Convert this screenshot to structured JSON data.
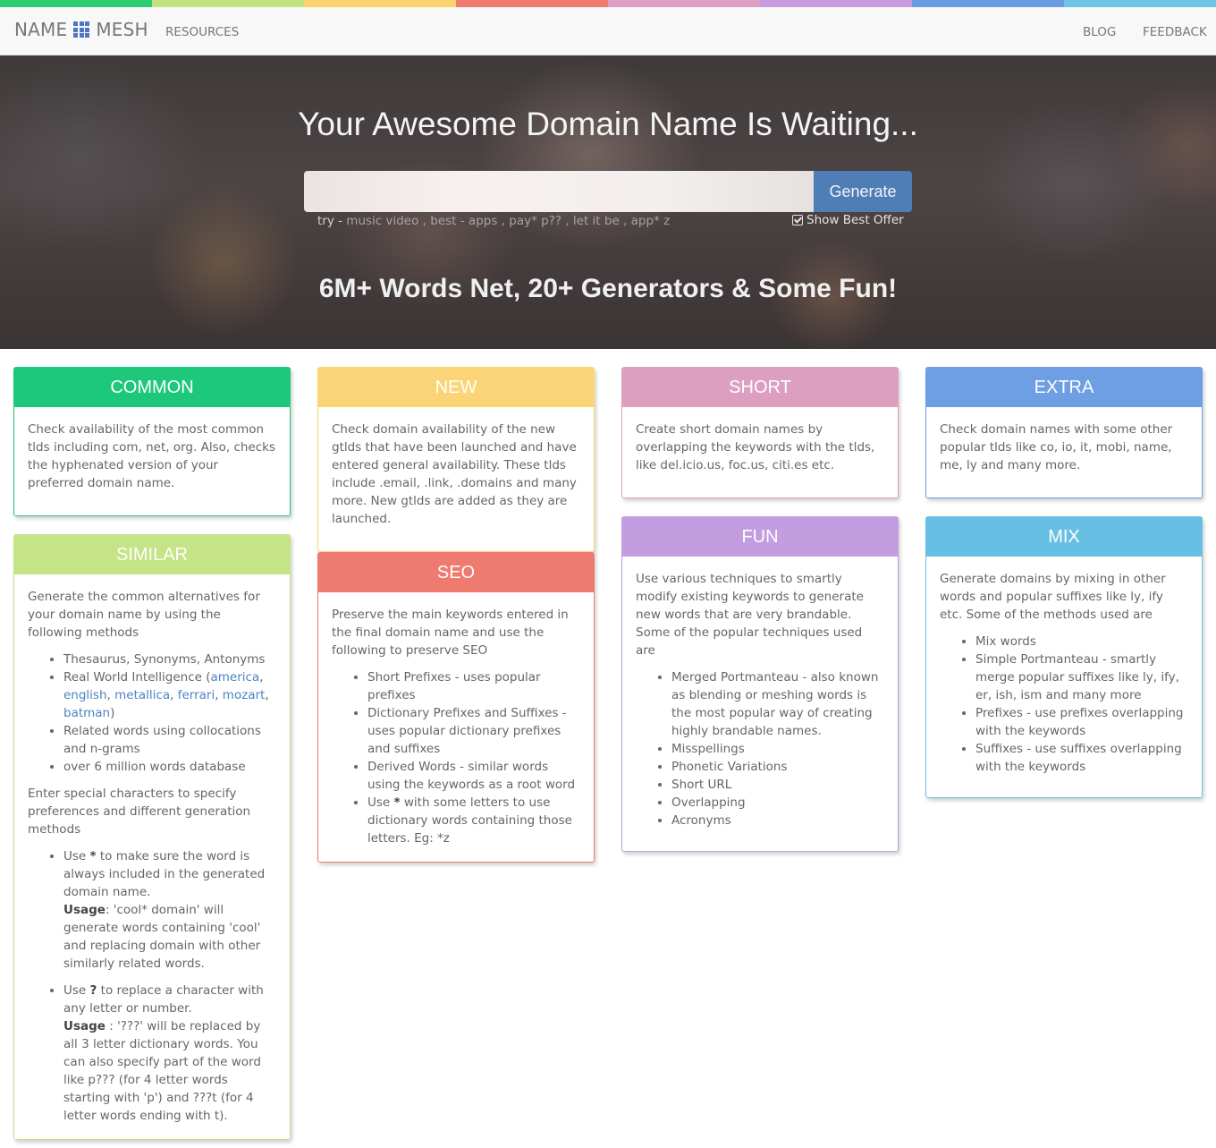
{
  "colors": {
    "strip": [
      "#2ecc71",
      "#c3e27f",
      "#fcd36f",
      "#ef7c6e",
      "#df9fc4",
      "#c79be0",
      "#6b9be3",
      "#6fc6e4"
    ],
    "common": "#1ec87a",
    "similar": "#c5e387",
    "new": "#fbd477",
    "seo": "#ef7a6f",
    "short": "#dc9fbf",
    "fun": "#c39ddf",
    "extra": "#6e9ee3",
    "mix": "#67c0e3"
  },
  "nav": {
    "brand_left": "NAME",
    "brand_icon": "grid-icon",
    "brand_right": "MESH",
    "resources": "RESOURCES",
    "blog": "BLOG",
    "feedback": "FEEDBACK"
  },
  "hero": {
    "title": "Your Awesome Domain Name Is Waiting...",
    "search_value": "",
    "search_placeholder": "",
    "generate_label": "Generate",
    "try_label": "try - ",
    "try_items": [
      "music video",
      "best - apps",
      "pay* p??",
      "let it be",
      "app* z"
    ],
    "show_best_offer": "Show Best Offer",
    "subtitle": "6M+ Words Net, 20+ Generators & Some Fun!"
  },
  "cards": {
    "common": {
      "title": "COMMON",
      "text": "Check availability of the most common tlds including com, net, org. Also, checks the hyphenated version of your preferred domain name."
    },
    "new": {
      "title": "NEW",
      "text": "Check domain availability of the new gtlds that have been launched and have entered general availability. These tlds include .email, .link, .domains and many more. New gtlds are added as they are launched."
    },
    "short": {
      "title": "SHORT",
      "text": "Create short domain names by overlapping the keywords with the tlds, like del.icio.us, foc.us, citi.es etc."
    },
    "extra": {
      "title": "EXTRA",
      "text": "Check domain names with some other popular tlds like co, io, it, mobi, name, me, ly and many more."
    },
    "similar": {
      "title": "SIMILAR",
      "intro": "Generate the common alternatives for your domain name by using the following methods",
      "item1": "Thesaurus, Synonyms, Antonyms",
      "item2_prefix": "Real World Intelligence (",
      "item2_links": [
        "america",
        "english",
        "metallica",
        "ferrari",
        "mozart",
        "batman"
      ],
      "item2_suffix": ")",
      "item3": "Related words using collocations and n-grams",
      "item4": "over 6 million words database",
      "special_intro": "Enter special characters to specify preferences and different generation methods",
      "star_pre": "Use ",
      "star_char": "*",
      "star_post": " to make sure the word is always included in the generated domain name.",
      "star_usage_label": "Usage",
      "star_usage_text": ": 'cool* domain' will generate words containing 'cool' and replacing domain with other similarly related words.",
      "q_pre": "Use ",
      "q_char": "?",
      "q_post": " to replace a character with any letter or number.",
      "q_usage_label": "Usage",
      "q_usage_text": " : '???' will be replaced by all 3 letter dictionary words. You can also specify part of the word like p??? (for 4 letter words starting with 'p') and ???t (for 4 letter words ending with t)."
    },
    "seo": {
      "title": "SEO",
      "intro": "Preserve the main keywords entered in the final domain name and use the following to preserve SEO",
      "items": [
        "Short Prefixes - uses popular prefixes",
        "Dictionary Prefixes and Suffixes - uses popular dictionary prefixes and suffixes",
        "Derived Words - similar words using the keywords as a root word"
      ],
      "last_pre": "Use ",
      "last_char": "*",
      "last_post": " with some letters to use dictionary words containing those letters. Eg: *z"
    },
    "fun": {
      "title": "FUN",
      "intro": "Use various techniques to smartly modify existing keywords to generate new words that are very brandable. Some of the popular techniques used are",
      "items": [
        "Merged Portmanteau - also known as blending or meshing words is the most popular way of creating highly brandable names.",
        "Misspellings",
        "Phonetic Variations",
        "Short URL",
        "Overlapping",
        "Acronyms"
      ]
    },
    "mix": {
      "title": "MIX",
      "intro": "Generate domains by mixing in other words and popular suffixes like ly, ify etc. Some of the methods used are",
      "items": [
        "Mix words",
        "Simple Portmanteau - smartly merge popular suffixes like ly, ify, er, ish, ism and many more",
        "Prefixes - use prefixes overlapping with the keywords",
        "Suffixes - use suffixes overlapping with the keywords"
      ]
    }
  }
}
